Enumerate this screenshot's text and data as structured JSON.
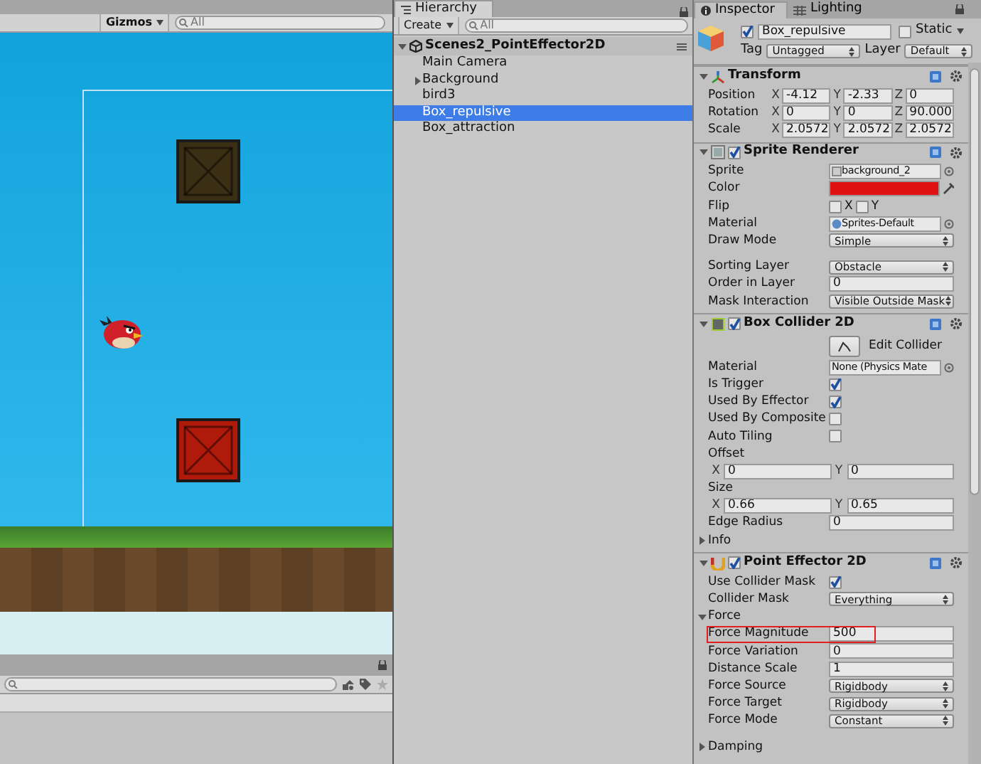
{
  "scene": {
    "gizmos": "Gizmos",
    "search_placeholder": "All"
  },
  "hierarchy": {
    "tab": "Hierarchy",
    "create": "Create",
    "search_placeholder": "All",
    "scene_name": "Scenes2_PointEffector2D",
    "items": [
      {
        "label": "Main Camera",
        "selected": false,
        "expandable": false
      },
      {
        "label": "Background",
        "selected": false,
        "expandable": true
      },
      {
        "label": "bird3",
        "selected": false,
        "expandable": false
      },
      {
        "label": "Box_repulsive",
        "selected": true,
        "expandable": false
      },
      {
        "label": "Box_attraction",
        "selected": false,
        "expandable": false
      }
    ]
  },
  "inspector": {
    "tabs": [
      {
        "label": "Inspector",
        "selected": true
      },
      {
        "label": "Lighting",
        "selected": false
      }
    ],
    "object": {
      "active": true,
      "name": "Box_repulsive",
      "static_label": "Static",
      "static": false,
      "tag_label": "Tag",
      "tag": "Untagged",
      "layer_label": "Layer",
      "layer": "Default"
    },
    "components": [
      {
        "kind": "transform",
        "title": "Transform",
        "expanded": true,
        "rows": [
          {
            "kind": "xyz",
            "label": "Position",
            "fields": [
              {
                "axis": "X",
                "value": "-4.12"
              },
              {
                "axis": "Y",
                "value": "-2.33"
              },
              {
                "axis": "Z",
                "value": "0"
              }
            ]
          },
          {
            "kind": "xyz",
            "label": "Rotation",
            "fields": [
              {
                "axis": "X",
                "value": "0"
              },
              {
                "axis": "Y",
                "value": "0"
              },
              {
                "axis": "Z",
                "value": "90.000"
              }
            ]
          },
          {
            "kind": "xyz",
            "label": "Scale",
            "fields": [
              {
                "axis": "X",
                "value": "2.0572"
              },
              {
                "axis": "Y",
                "value": "2.0572"
              },
              {
                "axis": "Z",
                "value": "2.0572"
              }
            ]
          }
        ]
      },
      {
        "kind": "sprite",
        "title": "Sprite Renderer",
        "enabled": true,
        "expanded": true,
        "rows": [
          {
            "kind": "sprite_ref",
            "label": "Sprite",
            "value": "background_2"
          },
          {
            "kind": "color",
            "label": "Color",
            "color": "#e01212"
          },
          {
            "kind": "toggles",
            "label": "Flip",
            "options": [
              {
                "label": "X",
                "checked": false
              },
              {
                "label": "Y",
                "checked": false
              }
            ]
          },
          {
            "kind": "material_ref",
            "label": "Material",
            "value": "Sprites-Default"
          },
          {
            "kind": "dropdown",
            "label": "Draw Mode",
            "value": "Simple"
          },
          {
            "kind": "spacer"
          },
          {
            "kind": "dropdown",
            "label": "Sorting Layer",
            "value": "Obstacle"
          },
          {
            "kind": "text",
            "label": "Order in Layer",
            "value": "0"
          },
          {
            "kind": "dropdown",
            "label": "Mask Interaction",
            "value": "Visible Outside Mask"
          }
        ]
      },
      {
        "kind": "collider",
        "title": "Box Collider 2D",
        "enabled": true,
        "expanded": true,
        "rows": [
          {
            "kind": "button",
            "label": "Edit Collider"
          },
          {
            "kind": "object",
            "label": "Material",
            "value": "None (Physics Mate"
          },
          {
            "kind": "check",
            "label": "Is Trigger",
            "checked": true
          },
          {
            "kind": "check",
            "label": "Used By Effector",
            "checked": true
          },
          {
            "kind": "check",
            "label": "Used By Composite",
            "checked": false
          },
          {
            "kind": "check",
            "label": "Auto Tiling",
            "checked": false
          },
          {
            "kind": "header",
            "label": "Offset"
          },
          {
            "kind": "xy",
            "fields": [
              {
                "axis": "X",
                "value": "0"
              },
              {
                "axis": "Y",
                "value": "0"
              }
            ]
          },
          {
            "kind": "header",
            "label": "Size"
          },
          {
            "kind": "xy",
            "fields": [
              {
                "axis": "X",
                "value": "0.66"
              },
              {
                "axis": "Y",
                "value": "0.65"
              }
            ]
          },
          {
            "kind": "text",
            "label": "Edge Radius",
            "value": "0"
          },
          {
            "kind": "foldout",
            "label": "Info",
            "expanded": false
          }
        ]
      },
      {
        "kind": "effector",
        "title": "Point Effector 2D",
        "enabled": true,
        "expanded": true,
        "rows": [
          {
            "kind": "check",
            "label": "Use Collider Mask",
            "checked": true
          },
          {
            "kind": "dropdown",
            "label": "Collider Mask",
            "value": "Everything"
          },
          {
            "kind": "foldout",
            "label": "Force",
            "expanded": true
          },
          {
            "kind": "text",
            "label": "Force Magnitude",
            "value": "500",
            "highlighted": true
          },
          {
            "kind": "text",
            "label": "Force Variation",
            "value": "0"
          },
          {
            "kind": "text",
            "label": "Distance Scale",
            "value": "1"
          },
          {
            "kind": "dropdown",
            "label": "Force Source",
            "value": "Rigidbody"
          },
          {
            "kind": "dropdown",
            "label": "Force Target",
            "value": "Rigidbody"
          },
          {
            "kind": "dropdown",
            "label": "Force Mode",
            "value": "Constant"
          },
          {
            "kind": "spacer"
          },
          {
            "kind": "foldout",
            "label": "Damping",
            "expanded": false
          }
        ]
      }
    ]
  }
}
